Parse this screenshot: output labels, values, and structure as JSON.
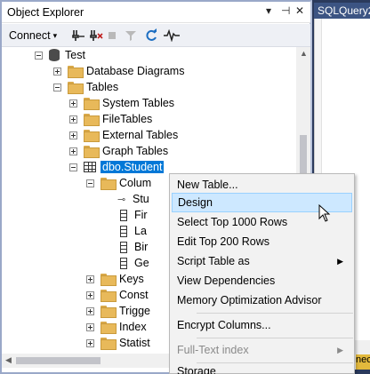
{
  "object_explorer": {
    "title": "Object Explorer",
    "title_controls": [
      "▾",
      "⊣",
      "✕"
    ],
    "toolbar": {
      "connect_label": "Connect",
      "connect_arrow": "▾",
      "icons": [
        "connect-icon",
        "disconnect-icon",
        "stop-icon",
        "filter-icon",
        "refresh-icon",
        "activity-monitor-icon"
      ]
    },
    "tree": {
      "database": "Test",
      "database_diagrams": "Database Diagrams",
      "tables": "Tables",
      "system_tables": "System Tables",
      "file_tables": "FileTables",
      "external_tables": "External Tables",
      "graph_tables": "Graph Tables",
      "selected_table": "dbo.Student",
      "columns_folder": "Colum",
      "columns": [
        "Stu",
        "Fir",
        "La",
        "Bir",
        "Ge"
      ],
      "keys": "Keys",
      "constraints": "Const",
      "triggers": "Trigge",
      "indexes": "Index",
      "statistics": "Statist"
    }
  },
  "query_tab": {
    "label": "SQLQuery2"
  },
  "status_strip": {
    "text": "nec"
  },
  "context_menu": {
    "items": [
      {
        "label": "New Table...",
        "highlighted": false,
        "disabled": false
      },
      {
        "label": "Design",
        "highlighted": true,
        "disabled": false
      },
      {
        "label": "Select Top 1000 Rows",
        "highlighted": false,
        "disabled": false
      },
      {
        "label": "Edit Top 200 Rows",
        "highlighted": false,
        "disabled": false
      },
      {
        "label": "Script Table as",
        "highlighted": false,
        "disabled": false,
        "submenu": true
      },
      {
        "label": "View Dependencies",
        "highlighted": false,
        "disabled": false
      },
      {
        "label": "Memory Optimization Advisor",
        "highlighted": false,
        "disabled": false
      },
      {
        "label": "Encrypt Columns...",
        "highlighted": false,
        "disabled": false
      },
      {
        "label": "Full-Text index",
        "highlighted": false,
        "disabled": true,
        "submenu": true
      },
      {
        "label": "Storage",
        "highlighted": false,
        "disabled": false
      }
    ],
    "submenu_arrow": "▶"
  },
  "colors": {
    "selection": "#0078d7",
    "menu_highlight": "#cde8ff",
    "folder": "#e8b95a",
    "tab_background": "#3c5483"
  }
}
